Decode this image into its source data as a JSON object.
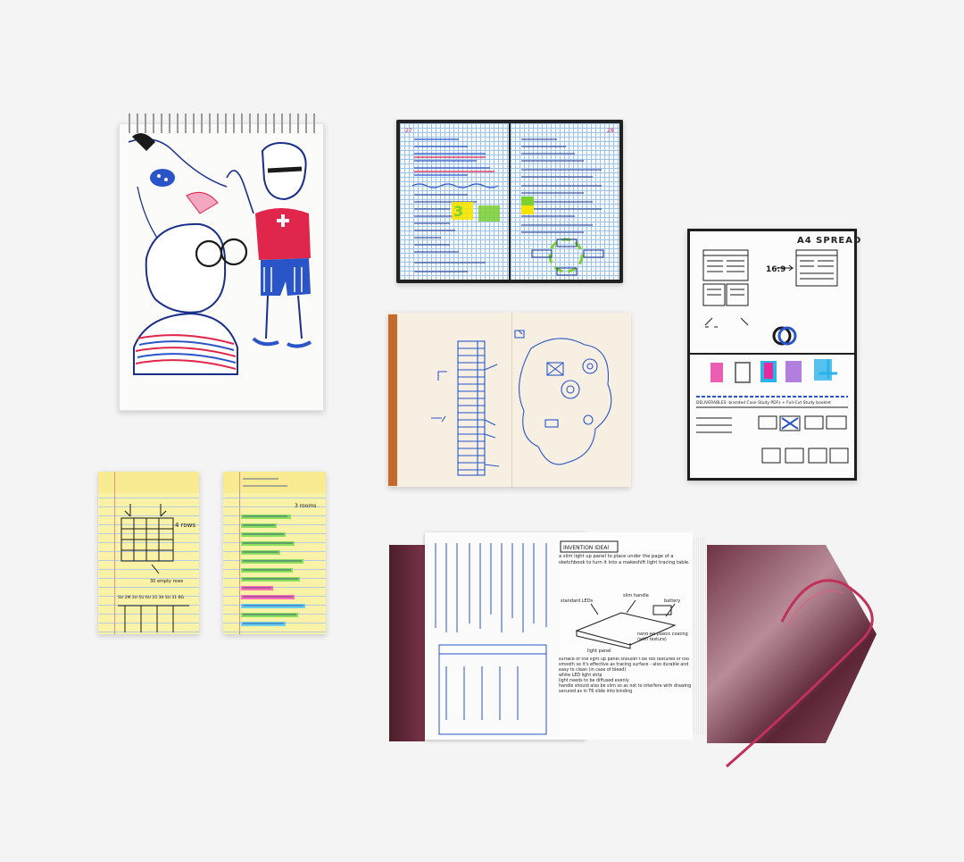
{
  "scene": {
    "background": "#f4f4f4",
    "items": {
      "sketchpad": {
        "colors": [
          "#1a2f8a",
          "#e0264a",
          "#2a55c8"
        ]
      },
      "grid_notebook": {
        "page_left_number": "27",
        "page_right_number": "28",
        "colors": [
          "#e0264a",
          "#2a55c8",
          "#7bd030",
          "#f6e400"
        ]
      },
      "keys_sketchbook": {
        "ink": "#2a55c8",
        "spine": "#c46a2c"
      },
      "wireframe_sketchbook": {
        "spread_label": "A4 SPREAD",
        "ratio_label": "16:9",
        "deliverables_text": "DELIVERABLES: branded Case Study PDFs + Full-Cut Study booklet",
        "swatches": [
          "#e72a9b",
          "#777777",
          "#2ab3e8",
          "#8a3ccf",
          "#2ab3e8"
        ]
      },
      "legal_pads": {
        "pad1_footer": "SU 2M 3U 5U 6U 22 30 SU 31 BG",
        "pad1_note": "30 empty rows",
        "pad1_label": "4 rows",
        "pad2_note": "3 rooms",
        "highlight_colors": [
          "#6ed94a",
          "#ff4fb4",
          "#46c7ff"
        ]
      },
      "leather_journal": {
        "heading": "INVENTION IDEA!",
        "intro": "a slim light up panel to place under the page of a sketchbook to turn it into a makeshift light tracing table.",
        "labels": [
          "standard LEDs",
          "slim handle",
          "battery",
          "light panel",
          "hand Alt plastic coating (with texture)"
        ],
        "notes": [
          "surface of the light up panel shouldn't be too textured or too smooth so it's effective as tracing surface - also durable and easy to clean (in case of bleed)",
          "white LED light strip",
          "light needs to be diffused evenly",
          "handle should also be slim so as not to interfere with drawing",
          "secured as in T6 slide into binding"
        ],
        "cover_color": "#7a3448",
        "bookmark_color": "#c2315a"
      }
    }
  }
}
